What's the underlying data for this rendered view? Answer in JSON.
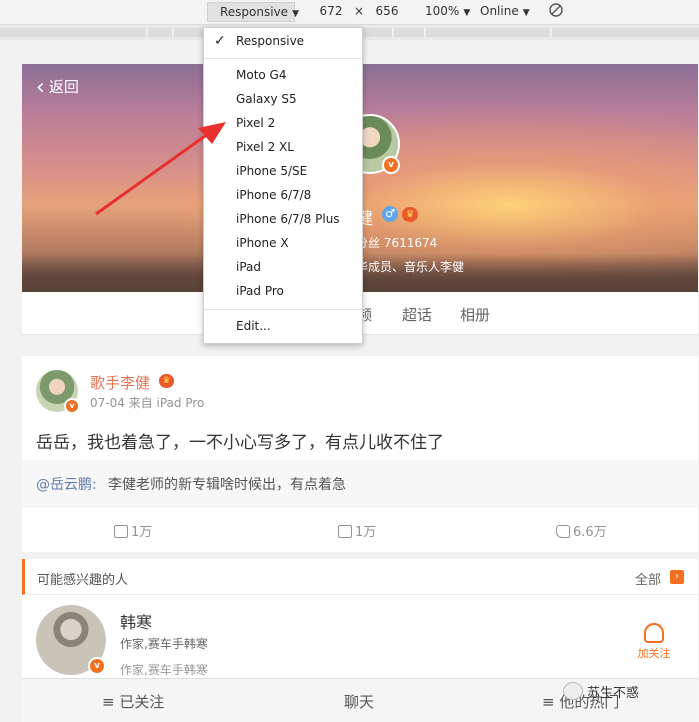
{
  "toolbar": {
    "device": "Responsive",
    "width": "672",
    "times": "×",
    "height": "656",
    "zoom": "100%",
    "throttle": "Online"
  },
  "device_menu": {
    "selected": "Responsive",
    "items": [
      "Moto G4",
      "Galaxy S5",
      "Pixel 2",
      "Pixel 2 XL",
      "iPhone 5/SE",
      "iPhone 6/7/8",
      "iPhone 6/7/8 Plus",
      "iPhone X",
      "iPad",
      "iPad Pro"
    ],
    "edit": "Edit..."
  },
  "profile": {
    "back": "返回",
    "name_fragment": "健",
    "fans_fragment": "分丝  7611674",
    "desc_fragment": "华成员、音乐人李健",
    "tabs": [
      "频",
      "超话",
      "相册"
    ],
    "gender_symbol": "♂",
    "verified_badge": "v"
  },
  "post": {
    "author": "歌手李健",
    "meta": "07-04 来自 iPad Pro",
    "text": "岳岳，我也着急了，一不小心写多了，有点儿收不住了",
    "repost_user": "@岳云鹏:",
    "repost_text": "李健老师的新专辑啥时候出，有点着急",
    "reposts": "1万",
    "comments": "1万",
    "likes": "6.6万"
  },
  "suggest": {
    "title": "可能感兴趣的人",
    "all": "全部",
    "name": "韩寒",
    "desc": "作家,赛车手韩寒",
    "desc2": "作家,赛车手韩寒",
    "follow": "加关注"
  },
  "bottombar": {
    "followed": "≡ 已关注",
    "chat": "聊天",
    "more": "≡ 他的热门"
  },
  "watermark": "苏生不惑",
  "colors": {
    "accent": "#f37021",
    "link": "#eb7350",
    "arrow": "#e8312f"
  }
}
